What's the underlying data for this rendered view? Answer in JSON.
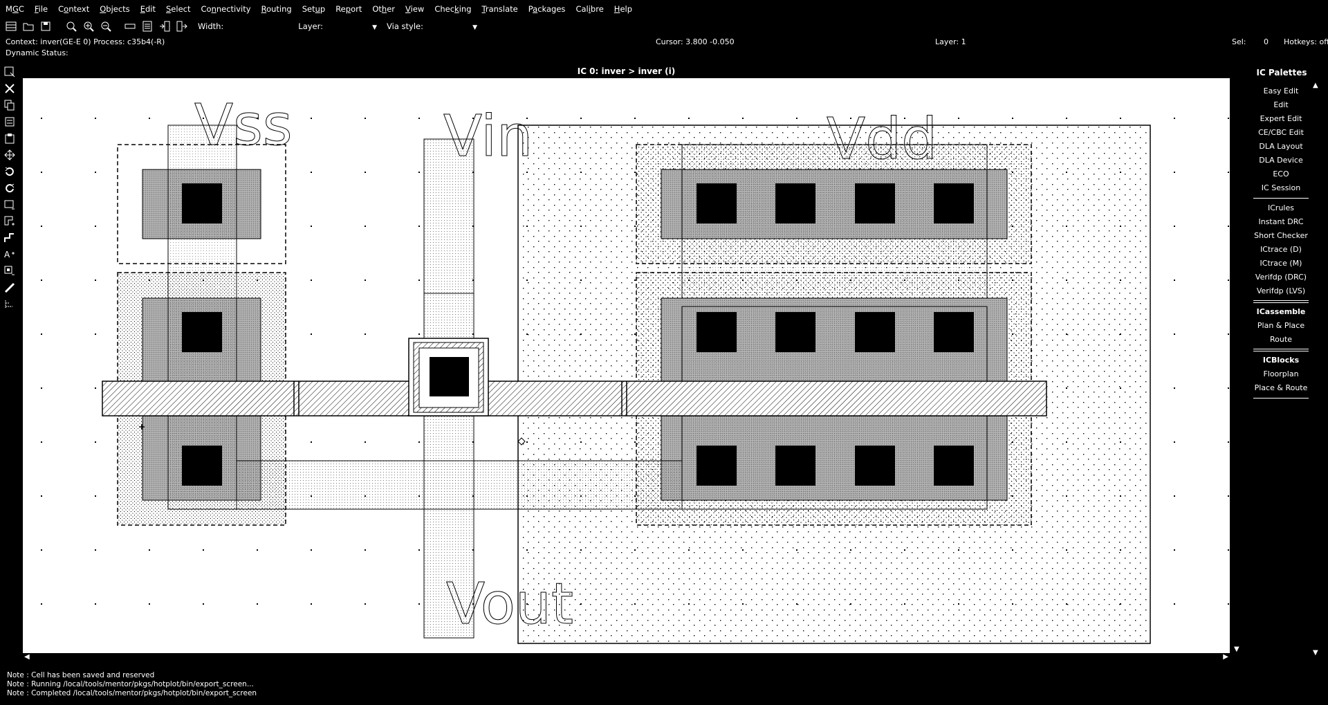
{
  "menubar": {
    "items": [
      {
        "id": "mgc",
        "pre": "M",
        "ul": "G",
        "post": "C"
      },
      {
        "id": "file",
        "pre": "",
        "ul": "F",
        "post": "ile"
      },
      {
        "id": "context",
        "pre": "C",
        "ul": "o",
        "post": "ntext"
      },
      {
        "id": "objects",
        "pre": "",
        "ul": "O",
        "post": "bjects"
      },
      {
        "id": "edit",
        "pre": "",
        "ul": "E",
        "post": "dit"
      },
      {
        "id": "select",
        "pre": "",
        "ul": "S",
        "post": "elect"
      },
      {
        "id": "connectivity",
        "pre": "Co",
        "ul": "n",
        "post": "nectivity"
      },
      {
        "id": "routing",
        "pre": "",
        "ul": "R",
        "post": "outing"
      },
      {
        "id": "setup",
        "pre": "Set",
        "ul": "u",
        "post": "p"
      },
      {
        "id": "report",
        "pre": "Re",
        "ul": "p",
        "post": "ort"
      },
      {
        "id": "other",
        "pre": "Ot",
        "ul": "h",
        "post": "er"
      },
      {
        "id": "view",
        "pre": "",
        "ul": "V",
        "post": "iew"
      },
      {
        "id": "checking",
        "pre": "Chec",
        "ul": "k",
        "post": "ing"
      },
      {
        "id": "translate",
        "pre": "",
        "ul": "T",
        "post": "ranslate"
      },
      {
        "id": "packages",
        "pre": "P",
        "ul": "a",
        "post": "ckages"
      },
      {
        "id": "calibre",
        "pre": "Cal",
        "ul": "i",
        "post": "bre"
      },
      {
        "id": "help",
        "pre": "",
        "ul": "H",
        "post": "elp"
      }
    ]
  },
  "toolbar": {
    "width_label": "Width:",
    "layer_label": "Layer:",
    "via_style_label": "Via style:"
  },
  "status": {
    "context": "Context: inver(GE-E 0)  Process: c35b4(-R)",
    "cursor": "Cursor: 3.800  -0.050",
    "layer": "Layer: 1",
    "sel_label": "Sel:",
    "sel_value": "0",
    "hotkeys": "Hotkeys: off",
    "dynamic": "Dynamic Status:"
  },
  "canvas": {
    "title": "IC 0: inver > inver (i)",
    "labels": {
      "vss": "Vss",
      "vin": "Vin",
      "vdd": "Vdd",
      "vout": "Vout"
    }
  },
  "palette": {
    "title": "IC Palettes",
    "items": [
      {
        "type": "item",
        "label": "Easy Edit"
      },
      {
        "type": "item",
        "label": "Edit"
      },
      {
        "type": "item",
        "label": "Expert Edit"
      },
      {
        "type": "item",
        "label": "CE/CBC Edit"
      },
      {
        "type": "item",
        "label": "DLA Layout"
      },
      {
        "type": "item",
        "label": "DLA Device"
      },
      {
        "type": "item",
        "label": "ECO"
      },
      {
        "type": "item",
        "label": "IC Session"
      },
      {
        "type": "sep"
      },
      {
        "type": "item",
        "label": "ICrules"
      },
      {
        "type": "item",
        "label": "Instant DRC"
      },
      {
        "type": "item",
        "label": "Short Checker"
      },
      {
        "type": "item",
        "label": "ICtrace (D)"
      },
      {
        "type": "item",
        "label": "ICtrace (M)"
      },
      {
        "type": "item",
        "label": "Verifdp (DRC)"
      },
      {
        "type": "item",
        "label": "Verifdp (LVS)"
      },
      {
        "type": "dsep"
      },
      {
        "type": "head",
        "label": "ICassemble"
      },
      {
        "type": "item",
        "label": "Plan & Place"
      },
      {
        "type": "item",
        "label": "Route"
      },
      {
        "type": "dsep"
      },
      {
        "type": "head",
        "label": "ICBlocks"
      },
      {
        "type": "item",
        "label": "Floorplan"
      },
      {
        "type": "item",
        "label": "Place & Route"
      },
      {
        "type": "sep"
      }
    ]
  },
  "log": [
    "Note : Cell has been saved and reserved",
    "Note : Running /local/tools/mentor/pkgs/hotplot/bin/export_screen...",
    "Note : Completed /local/tools/mentor/pkgs/hotplot/bin/export_screen"
  ]
}
